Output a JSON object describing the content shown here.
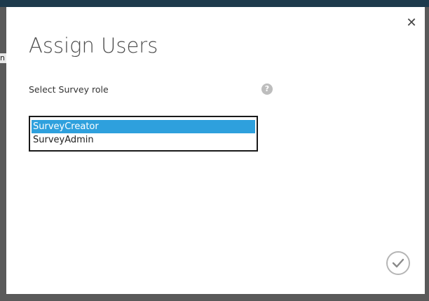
{
  "dialog": {
    "title": "Assign Users",
    "close_icon": "close-icon",
    "confirm_icon": "checkmark-icon"
  },
  "form": {
    "role_label": "Select Survey role",
    "help_icon": "help-icon",
    "help_glyph": "?",
    "options": [
      {
        "label": "SurveyCreator",
        "selected": true
      },
      {
        "label": "SurveyAdmin",
        "selected": false
      }
    ]
  },
  "background": {
    "fragment_text": "n"
  },
  "colors": {
    "selection": "#2ea0dd",
    "topbar": "#1e3a4c"
  }
}
